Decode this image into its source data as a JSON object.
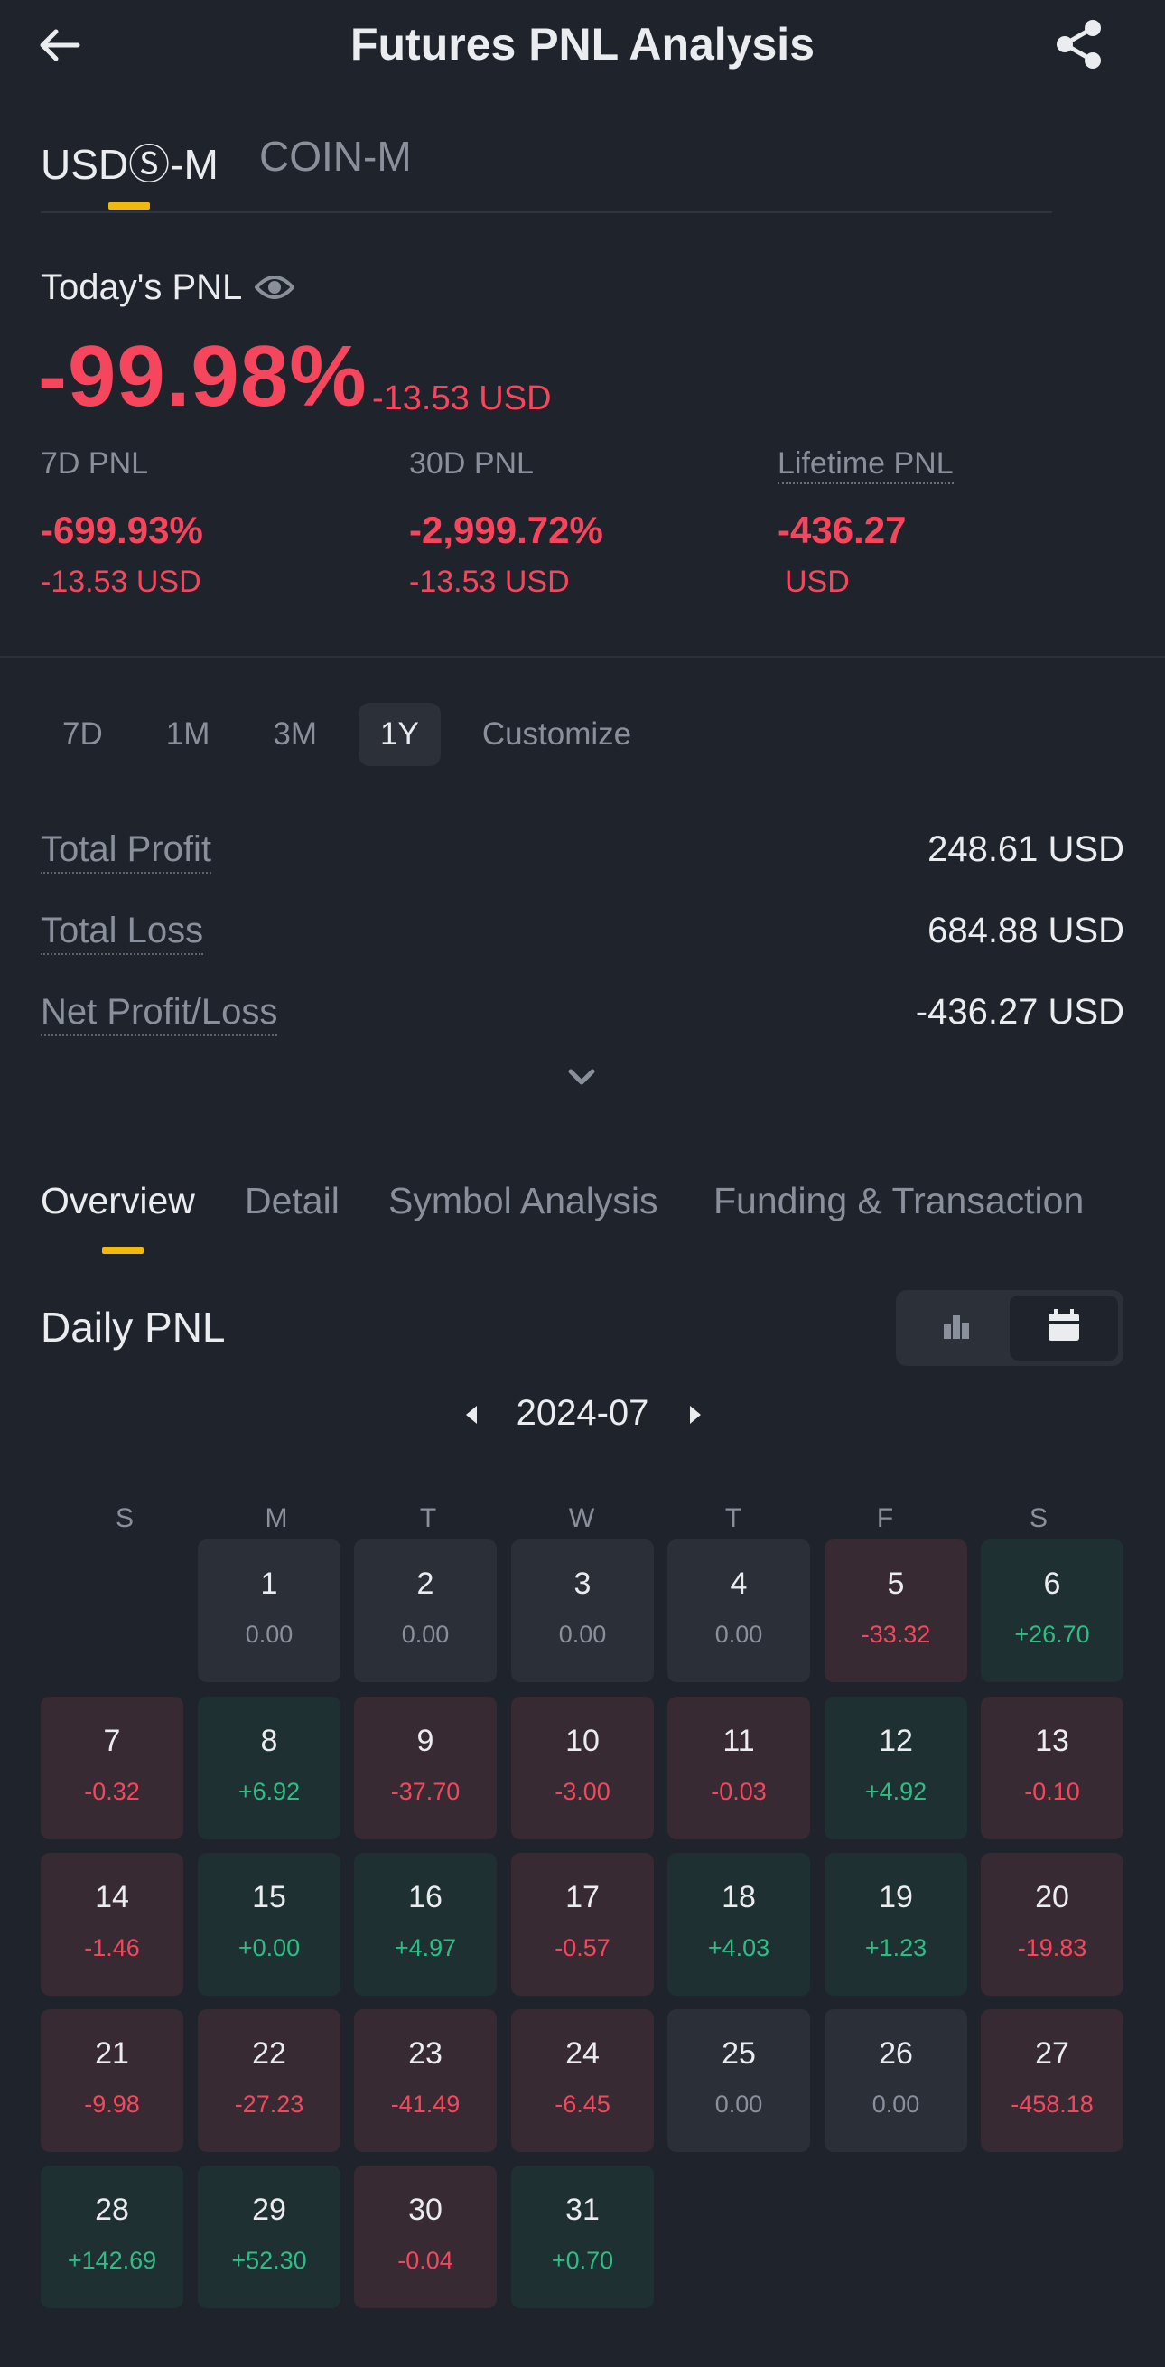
{
  "header": {
    "title": "Futures PNL Analysis"
  },
  "market_tabs": [
    {
      "label": "USDⓈ-M",
      "active": true
    },
    {
      "label": "COIN-M",
      "active": false
    }
  ],
  "today": {
    "label": "Today's PNL",
    "pct": "-99.98%",
    "usd": "-13.53 USD"
  },
  "stats": [
    {
      "label": "7D PNL",
      "pct": "-699.93%",
      "usd": "-13.53 USD"
    },
    {
      "label": "30D PNL",
      "pct": "-2,999.72%",
      "usd": "-13.53 USD"
    },
    {
      "label": "Lifetime PNL",
      "pct": "-436.27",
      "usd": "USD"
    }
  ],
  "range_tabs": [
    {
      "label": "7D",
      "active": false
    },
    {
      "label": "1M",
      "active": false
    },
    {
      "label": "3M",
      "active": false
    },
    {
      "label": "1Y",
      "active": true
    },
    {
      "label": "Customize",
      "active": false
    }
  ],
  "summary": [
    {
      "label": "Total Profit",
      "value": "248.61 USD"
    },
    {
      "label": "Total Loss",
      "value": "684.88 USD"
    },
    {
      "label": "Net Profit/Loss",
      "value": "-436.27 USD"
    }
  ],
  "sub_tabs": [
    {
      "label": "Overview",
      "active": true
    },
    {
      "label": "Detail",
      "active": false
    },
    {
      "label": "Symbol Analysis",
      "active": false
    },
    {
      "label": "Funding & Transaction",
      "active": false
    }
  ],
  "daily": {
    "title": "Daily PNL",
    "month": "2024-07",
    "weekdays": [
      "S",
      "M",
      "T",
      "W",
      "T",
      "F",
      "S"
    ],
    "days": [
      {
        "day": "1",
        "value": "0.00",
        "status": "neutral"
      },
      {
        "day": "2",
        "value": "0.00",
        "status": "neutral"
      },
      {
        "day": "3",
        "value": "0.00",
        "status": "neutral"
      },
      {
        "day": "4",
        "value": "0.00",
        "status": "neutral"
      },
      {
        "day": "5",
        "value": "-33.32",
        "status": "loss"
      },
      {
        "day": "6",
        "value": "+26.70",
        "status": "gain"
      },
      {
        "day": "7",
        "value": "-0.32",
        "status": "loss"
      },
      {
        "day": "8",
        "value": "+6.92",
        "status": "gain"
      },
      {
        "day": "9",
        "value": "-37.70",
        "status": "loss"
      },
      {
        "day": "10",
        "value": "-3.00",
        "status": "loss"
      },
      {
        "day": "11",
        "value": "-0.03",
        "status": "loss"
      },
      {
        "day": "12",
        "value": "+4.92",
        "status": "gain"
      },
      {
        "day": "13",
        "value": "-0.10",
        "status": "loss"
      },
      {
        "day": "14",
        "value": "-1.46",
        "status": "loss"
      },
      {
        "day": "15",
        "value": "+0.00",
        "status": "gain"
      },
      {
        "day": "16",
        "value": "+4.97",
        "status": "gain"
      },
      {
        "day": "17",
        "value": "-0.57",
        "status": "loss"
      },
      {
        "day": "18",
        "value": "+4.03",
        "status": "gain"
      },
      {
        "day": "19",
        "value": "+1.23",
        "status": "gain"
      },
      {
        "day": "20",
        "value": "-19.83",
        "status": "loss"
      },
      {
        "day": "21",
        "value": "-9.98",
        "status": "loss"
      },
      {
        "day": "22",
        "value": "-27.23",
        "status": "loss"
      },
      {
        "day": "23",
        "value": "-41.49",
        "status": "loss"
      },
      {
        "day": "24",
        "value": "-6.45",
        "status": "loss"
      },
      {
        "day": "25",
        "value": "0.00",
        "status": "neutral"
      },
      {
        "day": "26",
        "value": "0.00",
        "status": "neutral"
      },
      {
        "day": "27",
        "value": "-458.18",
        "status": "loss"
      },
      {
        "day": "28",
        "value": "+142.69",
        "status": "gain"
      },
      {
        "day": "29",
        "value": "+52.30",
        "status": "gain"
      },
      {
        "day": "30",
        "value": "-0.04",
        "status": "loss"
      },
      {
        "day": "31",
        "value": "+0.70",
        "status": "gain"
      }
    ]
  },
  "colors": {
    "accent": "#f0b90b",
    "loss": "#f6465d",
    "gain": "#2ebd85",
    "background": "#1f232b"
  }
}
